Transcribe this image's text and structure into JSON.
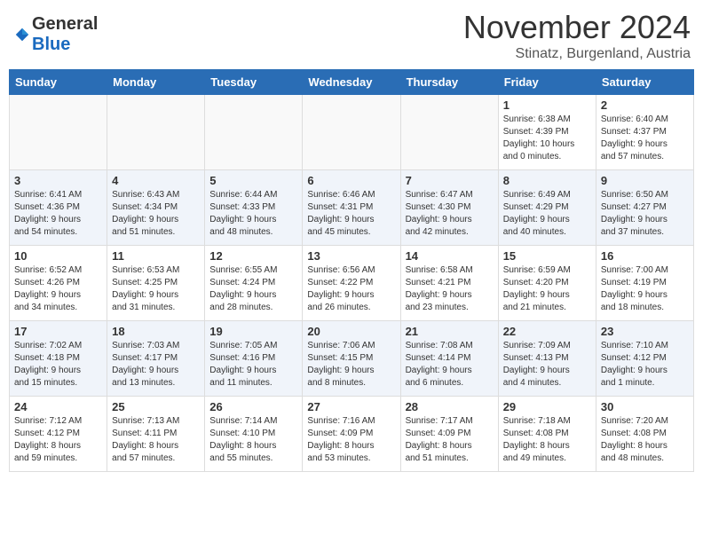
{
  "header": {
    "logo_line1": "General",
    "logo_line2": "Blue",
    "month_title": "November 2024",
    "subtitle": "Stinatz, Burgenland, Austria"
  },
  "weekdays": [
    "Sunday",
    "Monday",
    "Tuesday",
    "Wednesday",
    "Thursday",
    "Friday",
    "Saturday"
  ],
  "weeks": [
    [
      {
        "day": "",
        "info": ""
      },
      {
        "day": "",
        "info": ""
      },
      {
        "day": "",
        "info": ""
      },
      {
        "day": "",
        "info": ""
      },
      {
        "day": "",
        "info": ""
      },
      {
        "day": "1",
        "info": "Sunrise: 6:38 AM\nSunset: 4:39 PM\nDaylight: 10 hours\nand 0 minutes."
      },
      {
        "day": "2",
        "info": "Sunrise: 6:40 AM\nSunset: 4:37 PM\nDaylight: 9 hours\nand 57 minutes."
      }
    ],
    [
      {
        "day": "3",
        "info": "Sunrise: 6:41 AM\nSunset: 4:36 PM\nDaylight: 9 hours\nand 54 minutes."
      },
      {
        "day": "4",
        "info": "Sunrise: 6:43 AM\nSunset: 4:34 PM\nDaylight: 9 hours\nand 51 minutes."
      },
      {
        "day": "5",
        "info": "Sunrise: 6:44 AM\nSunset: 4:33 PM\nDaylight: 9 hours\nand 48 minutes."
      },
      {
        "day": "6",
        "info": "Sunrise: 6:46 AM\nSunset: 4:31 PM\nDaylight: 9 hours\nand 45 minutes."
      },
      {
        "day": "7",
        "info": "Sunrise: 6:47 AM\nSunset: 4:30 PM\nDaylight: 9 hours\nand 42 minutes."
      },
      {
        "day": "8",
        "info": "Sunrise: 6:49 AM\nSunset: 4:29 PM\nDaylight: 9 hours\nand 40 minutes."
      },
      {
        "day": "9",
        "info": "Sunrise: 6:50 AM\nSunset: 4:27 PM\nDaylight: 9 hours\nand 37 minutes."
      }
    ],
    [
      {
        "day": "10",
        "info": "Sunrise: 6:52 AM\nSunset: 4:26 PM\nDaylight: 9 hours\nand 34 minutes."
      },
      {
        "day": "11",
        "info": "Sunrise: 6:53 AM\nSunset: 4:25 PM\nDaylight: 9 hours\nand 31 minutes."
      },
      {
        "day": "12",
        "info": "Sunrise: 6:55 AM\nSunset: 4:24 PM\nDaylight: 9 hours\nand 28 minutes."
      },
      {
        "day": "13",
        "info": "Sunrise: 6:56 AM\nSunset: 4:22 PM\nDaylight: 9 hours\nand 26 minutes."
      },
      {
        "day": "14",
        "info": "Sunrise: 6:58 AM\nSunset: 4:21 PM\nDaylight: 9 hours\nand 23 minutes."
      },
      {
        "day": "15",
        "info": "Sunrise: 6:59 AM\nSunset: 4:20 PM\nDaylight: 9 hours\nand 21 minutes."
      },
      {
        "day": "16",
        "info": "Sunrise: 7:00 AM\nSunset: 4:19 PM\nDaylight: 9 hours\nand 18 minutes."
      }
    ],
    [
      {
        "day": "17",
        "info": "Sunrise: 7:02 AM\nSunset: 4:18 PM\nDaylight: 9 hours\nand 15 minutes."
      },
      {
        "day": "18",
        "info": "Sunrise: 7:03 AM\nSunset: 4:17 PM\nDaylight: 9 hours\nand 13 minutes."
      },
      {
        "day": "19",
        "info": "Sunrise: 7:05 AM\nSunset: 4:16 PM\nDaylight: 9 hours\nand 11 minutes."
      },
      {
        "day": "20",
        "info": "Sunrise: 7:06 AM\nSunset: 4:15 PM\nDaylight: 9 hours\nand 8 minutes."
      },
      {
        "day": "21",
        "info": "Sunrise: 7:08 AM\nSunset: 4:14 PM\nDaylight: 9 hours\nand 6 minutes."
      },
      {
        "day": "22",
        "info": "Sunrise: 7:09 AM\nSunset: 4:13 PM\nDaylight: 9 hours\nand 4 minutes."
      },
      {
        "day": "23",
        "info": "Sunrise: 7:10 AM\nSunset: 4:12 PM\nDaylight: 9 hours\nand 1 minute."
      }
    ],
    [
      {
        "day": "24",
        "info": "Sunrise: 7:12 AM\nSunset: 4:12 PM\nDaylight: 8 hours\nand 59 minutes."
      },
      {
        "day": "25",
        "info": "Sunrise: 7:13 AM\nSunset: 4:11 PM\nDaylight: 8 hours\nand 57 minutes."
      },
      {
        "day": "26",
        "info": "Sunrise: 7:14 AM\nSunset: 4:10 PM\nDaylight: 8 hours\nand 55 minutes."
      },
      {
        "day": "27",
        "info": "Sunrise: 7:16 AM\nSunset: 4:09 PM\nDaylight: 8 hours\nand 53 minutes."
      },
      {
        "day": "28",
        "info": "Sunrise: 7:17 AM\nSunset: 4:09 PM\nDaylight: 8 hours\nand 51 minutes."
      },
      {
        "day": "29",
        "info": "Sunrise: 7:18 AM\nSunset: 4:08 PM\nDaylight: 8 hours\nand 49 minutes."
      },
      {
        "day": "30",
        "info": "Sunrise: 7:20 AM\nSunset: 4:08 PM\nDaylight: 8 hours\nand 48 minutes."
      }
    ]
  ]
}
